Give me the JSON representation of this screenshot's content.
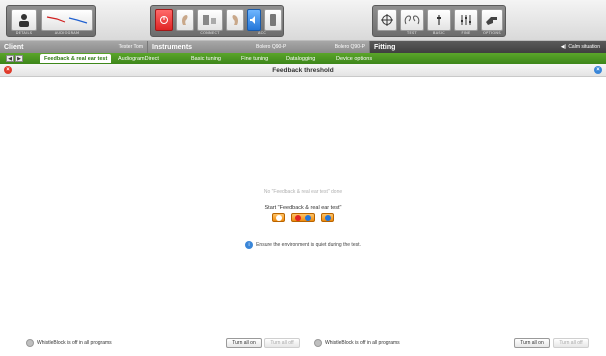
{
  "toolbar": {
    "groups": [
      {
        "labels": [
          "DETAILS",
          "AUDIOGRAM"
        ]
      },
      {
        "labels": [
          "CONNECT",
          "ACC"
        ]
      },
      {
        "labels": [
          "TEST",
          "BASIC",
          "FINE",
          "OPTIONS"
        ]
      }
    ]
  },
  "header": {
    "client_title": "Client",
    "client_name": "Tester Tom",
    "instruments_title": "Instruments",
    "instrument_left": "Bolero Q90-P",
    "instrument_right": "Bolero Q90-P",
    "fitting_title": "Fitting",
    "situation": "Calm situation"
  },
  "tabs": [
    {
      "label": "Feedback & real ear test",
      "active": true
    },
    {
      "label": "AudiogramDirect",
      "active": false
    },
    {
      "label": "Basic tuning",
      "active": false
    },
    {
      "label": "Fine tuning",
      "active": false
    },
    {
      "label": "Datalogging",
      "active": false
    },
    {
      "label": "Device options",
      "active": false
    }
  ],
  "section": {
    "title": "Feedback threshold"
  },
  "main": {
    "status": "No \"Feedback & real ear test\" done",
    "start_label": "Start \"Feedback & real ear test\"",
    "hint": "Ensure the environment is quiet during the test."
  },
  "footer": {
    "left": {
      "status": "WhistleBlock is off in all programs",
      "on_label": "Turn all on",
      "off_label": "Turn all off"
    },
    "right": {
      "status": "WhistleBlock is off in all programs",
      "on_label": "Turn all on",
      "off_label": "Turn all off"
    }
  },
  "colors": {
    "accent_green": "#3d861a",
    "orange": "#f08b0c",
    "red": "#e02424",
    "blue": "#2476d8"
  }
}
